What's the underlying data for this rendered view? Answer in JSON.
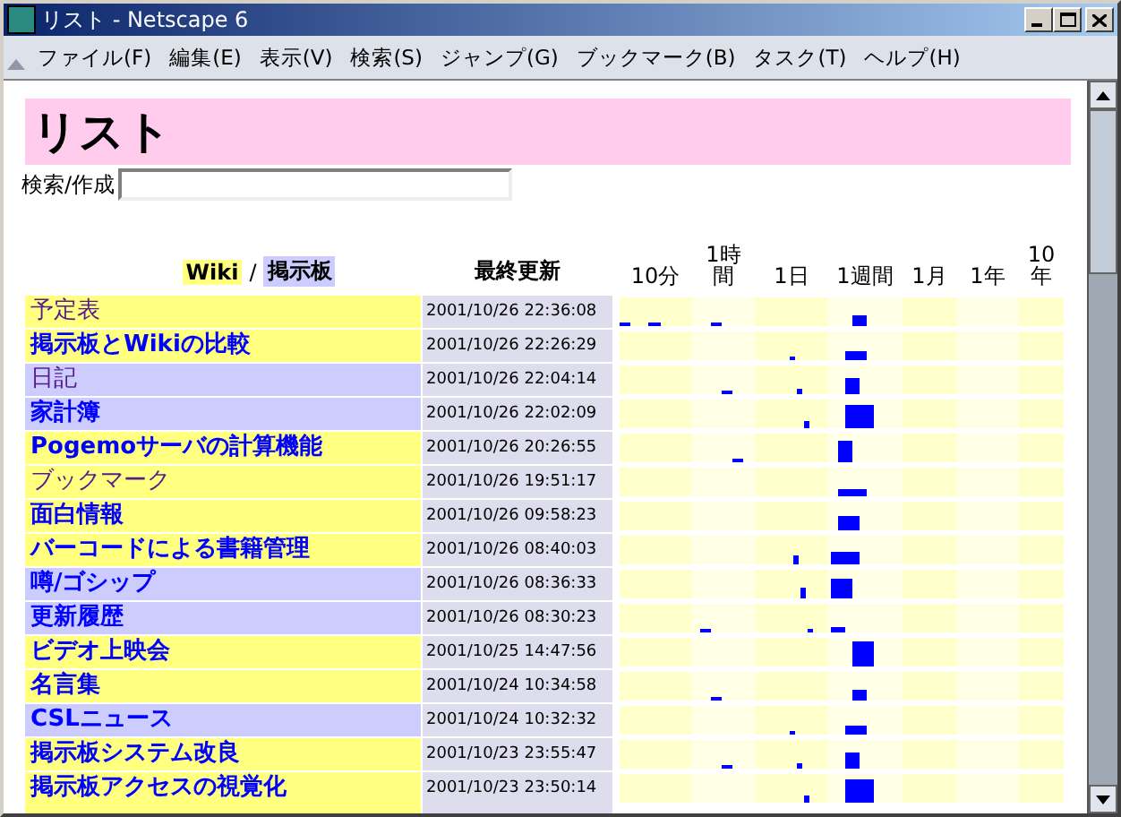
{
  "window": {
    "title": "リスト - Netscape 6"
  },
  "menu": [
    "ファイル(F)",
    "編集(E)",
    "表示(V)",
    "検索(S)",
    "ジャンプ(G)",
    "ブックマーク(B)",
    "タスク(T)",
    "ヘルプ(H)"
  ],
  "page": {
    "heading": "リスト",
    "search_label": "検索/作成"
  },
  "table": {
    "legend": [
      {
        "label": "Wiki",
        "kind": "wiki"
      },
      {
        "label": "掲示板",
        "kind": "bbs"
      }
    ],
    "legend_separator": "/",
    "date_header": "最終更新",
    "periods": [
      "10分",
      "1時間",
      "1日",
      "1週間",
      "1月",
      "1年",
      "10年"
    ],
    "rows": [
      {
        "name": "予定表",
        "kind": "wiki",
        "visited": true,
        "updated": "2001/10/26 22:36:08"
      },
      {
        "name": "掲示板とWikiの比較",
        "kind": "wiki",
        "visited": false,
        "updated": "2001/10/26 22:26:29"
      },
      {
        "name": "日記",
        "kind": "bbs",
        "visited": true,
        "updated": "2001/10/26 22:04:14"
      },
      {
        "name": "家計簿",
        "kind": "bbs",
        "visited": false,
        "updated": "2001/10/26 22:02:09"
      },
      {
        "name": "Pogemoサーバの計算機能",
        "kind": "wiki",
        "visited": false,
        "updated": "2001/10/26 20:26:55"
      },
      {
        "name": "ブックマーク",
        "kind": "wiki",
        "visited": true,
        "updated": "2001/10/26 19:51:17"
      },
      {
        "name": "面白情報",
        "kind": "wiki",
        "visited": false,
        "updated": "2001/10/26 09:58:23"
      },
      {
        "name": "バーコードによる書籍管理",
        "kind": "wiki",
        "visited": false,
        "updated": "2001/10/26 08:40:03"
      },
      {
        "name": "噂/ゴシップ",
        "kind": "bbs",
        "visited": false,
        "updated": "2001/10/26 08:36:33"
      },
      {
        "name": "更新履歴",
        "kind": "bbs",
        "visited": false,
        "updated": "2001/10/26 08:30:23"
      },
      {
        "name": "ビデオ上映会",
        "kind": "wiki",
        "visited": false,
        "updated": "2001/10/25 14:47:56"
      },
      {
        "name": "名言集",
        "kind": "wiki",
        "visited": false,
        "updated": "2001/10/24 10:34:58"
      },
      {
        "name": "CSLニュース",
        "kind": "bbs",
        "visited": false,
        "updated": "2001/10/24 10:32:32"
      },
      {
        "name": "掲示板システム改良",
        "kind": "wiki",
        "visited": false,
        "updated": "2001/10/23 23:55:47"
      },
      {
        "name": "掲示板アクセスの視覚化",
        "kind": "wiki",
        "visited": false,
        "updated": "2001/10/23 23:50:14"
      }
    ]
  }
}
